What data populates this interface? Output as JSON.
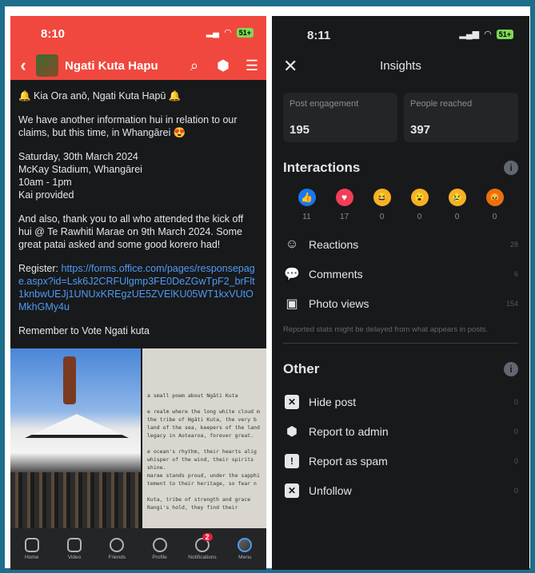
{
  "left": {
    "status": {
      "time": "8:10",
      "battery": "51+"
    },
    "header": {
      "title": "Ngati Kuta Hapu"
    },
    "post": {
      "greeting": "🔔 Kia Ora anō, Ngati Kuta Hapū 🔔",
      "p1": "We have another information hui in relation to our claims, but this time, in Whangārei 😍",
      "event_line1": "Saturday, 30th March 2024",
      "event_line2": "McKay Stadium, Whangārei",
      "event_line3": "10am - 1pm",
      "event_line4": "Kai provided",
      "p3": "And also, thank you to all who attended the kick off hui @ Te Rawhiti Marae on 9th March 2024. Some great patai asked and some good korero had!",
      "register_label": "Register: ",
      "register_link": "https://forms.office.com/pages/responsepage.aspx?id=Lsk6J2CRFUlgmp3FE0DeZGwTpF2_brFlt1knbwUEJj1UNUxKREgzUE5ZVElKU05WT1kxVUtOMkhGMy4u",
      "p5": "Remember to Vote Ngati kuta"
    },
    "photo_text": [
      "a small poem about Ngāti Kuta",
      "",
      "e realm where the long white cloud m",
      "the tribe of Ngāti Kuta, the very b",
      "land of the sea, keepers of the land",
      "legacy in Aotearoa, forever great.",
      "",
      "e ocean's rhythm, their hearts alig",
      "whisper of the wind, their spirits",
      "shine.",
      "marae stands proud, under the sapphi",
      "tement to their heritage, so fear n",
      "",
      "Kuta, tribe of strength and grace",
      "Rangi's hold, they find their"
    ],
    "nav": [
      {
        "label": "Home"
      },
      {
        "label": "Video"
      },
      {
        "label": "Friends"
      },
      {
        "label": "Profile"
      },
      {
        "label": "Notifications",
        "badge": "2"
      },
      {
        "label": "Menu"
      }
    ]
  },
  "right": {
    "status": {
      "time": "8:11",
      "battery": "51+"
    },
    "title": "Insights",
    "stats": [
      {
        "label": "Post engagement",
        "value": "195"
      },
      {
        "label": "People reached",
        "value": "397"
      }
    ],
    "interactions_title": "Interactions",
    "reactions": [
      {
        "name": "like",
        "count": "11",
        "color": "#1877f2",
        "glyph": "👍"
      },
      {
        "name": "love",
        "count": "17",
        "color": "#f33e58",
        "glyph": "♥"
      },
      {
        "name": "haha",
        "count": "0",
        "color": "#f7b125",
        "glyph": "😆"
      },
      {
        "name": "wow",
        "count": "0",
        "color": "#f7b125",
        "glyph": "😮"
      },
      {
        "name": "sad",
        "count": "0",
        "color": "#f7b125",
        "glyph": "😢"
      },
      {
        "name": "angry",
        "count": "0",
        "color": "#e9710f",
        "glyph": "😡"
      }
    ],
    "metrics": [
      {
        "label": "Reactions",
        "value": "28"
      },
      {
        "label": "Comments",
        "value": "6"
      },
      {
        "label": "Photo views",
        "value": "154"
      }
    ],
    "disclaimer": "Reported stats might be delayed from what appears in posts.",
    "other_title": "Other",
    "other": [
      {
        "label": "Hide post",
        "value": "0"
      },
      {
        "label": "Report to admin",
        "value": "0"
      },
      {
        "label": "Report as spam",
        "value": "0"
      },
      {
        "label": "Unfollow",
        "value": "0"
      }
    ]
  }
}
